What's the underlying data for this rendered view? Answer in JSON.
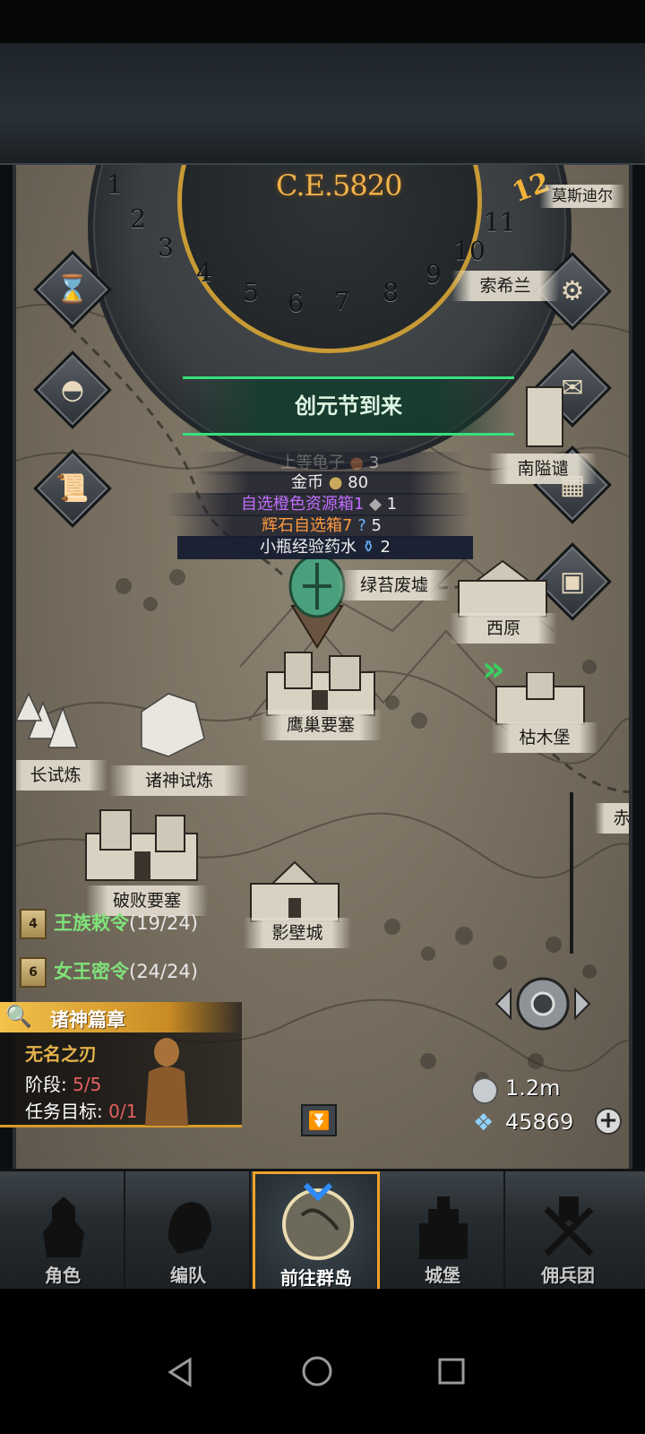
{
  "dial": {
    "year": "C.E.5820",
    "current_month": "12",
    "numbers": [
      "1",
      "2",
      "3",
      "4",
      "5",
      "6",
      "7",
      "8",
      "9",
      "10",
      "11"
    ]
  },
  "places": {
    "mosidier": "莫斯迪尔",
    "suoxilan": "索希兰",
    "nanqiao": "南隘谴",
    "lutai": "绿苔废墟",
    "xiyuan": "西原",
    "yingchao": "鹰巢要塞",
    "kumu": "枯木堡",
    "changshilian": "长试炼",
    "zhushen": "诸神试炼",
    "pobai": "破败要塞",
    "yingbi": "影壁城",
    "chi": "赤"
  },
  "event": {
    "title": "创元节到来",
    "rewards": [
      {
        "label": "上等龟子",
        "qty": "3",
        "color": "#9e9a93"
      },
      {
        "label": "金币",
        "qty": "80",
        "color": "#ffffff"
      },
      {
        "label": "自选橙色资源箱1",
        "qty": "1",
        "color": "#c06cff"
      },
      {
        "label": "辉石自选箱7",
        "qty": "5",
        "color": "#ff9a3c"
      },
      {
        "label": "小瓶经验药水",
        "qty": "2",
        "color": "#ffffff"
      }
    ]
  },
  "quests": [
    {
      "badge": "4",
      "name": "王族敕令",
      "progress": "(19/24)"
    },
    {
      "badge": "6",
      "name": "女王密令",
      "progress": "(24/24)"
    }
  ],
  "chapter": {
    "title": "诸神篇章",
    "name": "无名之刃",
    "stage_label": "阶段:",
    "stage_value": "5/5",
    "goal_label": "任务目标:",
    "goal_value": "0/1"
  },
  "resources": {
    "silver": "1.2m",
    "gems": "45869"
  },
  "nav": [
    {
      "label": "角色"
    },
    {
      "label": "编队"
    },
    {
      "label": "前往群岛"
    },
    {
      "label": "城堡"
    },
    {
      "label": "佣兵团"
    }
  ],
  "colors": {
    "accent_gold": "#f0a22a",
    "event_green": "#37e07d",
    "quest_green": "#7fe27a"
  }
}
